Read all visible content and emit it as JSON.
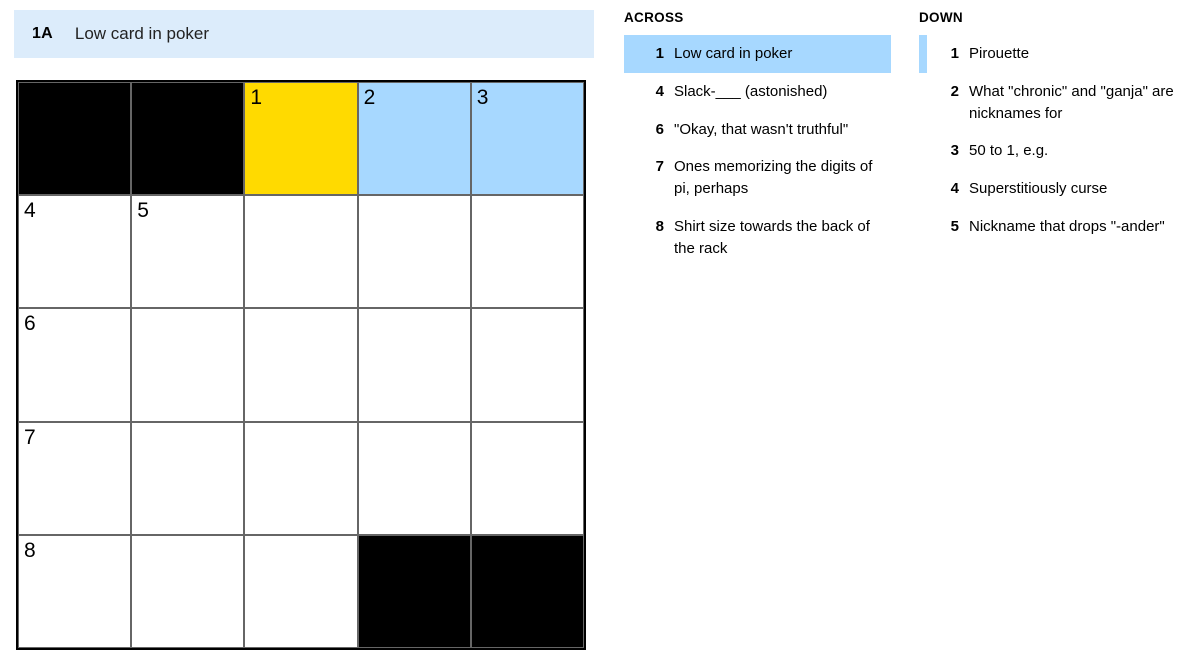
{
  "active_clue": {
    "label": "1A",
    "text": "Low card in poker"
  },
  "grid": {
    "size": 5,
    "cells": [
      [
        {
          "black": true
        },
        {
          "black": true
        },
        {
          "num": "1",
          "state": "focus"
        },
        {
          "num": "2",
          "state": "hl"
        },
        {
          "num": "3",
          "state": "hl"
        }
      ],
      [
        {
          "num": "4"
        },
        {
          "num": "5"
        },
        {},
        {},
        {}
      ],
      [
        {
          "num": "6"
        },
        {},
        {},
        {},
        {}
      ],
      [
        {
          "num": "7"
        },
        {},
        {},
        {},
        {}
      ],
      [
        {
          "num": "8"
        },
        {},
        {},
        {
          "black": true
        },
        {
          "black": true
        }
      ]
    ]
  },
  "clues": {
    "across": {
      "header": "ACROSS",
      "items": [
        {
          "num": "1",
          "text": "Low card in poker",
          "active": true
        },
        {
          "num": "4",
          "text": "Slack-___ (astonished)"
        },
        {
          "num": "6",
          "text": "\"Okay, that wasn't truthful\""
        },
        {
          "num": "7",
          "text": "Ones memorizing the digits of pi, perhaps"
        },
        {
          "num": "8",
          "text": "Shirt size towards the back of the rack"
        }
      ]
    },
    "down": {
      "header": "DOWN",
      "items": [
        {
          "num": "1",
          "text": "Pirouette",
          "related": true
        },
        {
          "num": "2",
          "text": "What \"chronic\" and \"ganja\" are nicknames for"
        },
        {
          "num": "3",
          "text": "50 to 1, e.g."
        },
        {
          "num": "4",
          "text": "Superstitiously curse"
        },
        {
          "num": "5",
          "text": "Nickname that drops \"-ander\""
        }
      ]
    }
  }
}
